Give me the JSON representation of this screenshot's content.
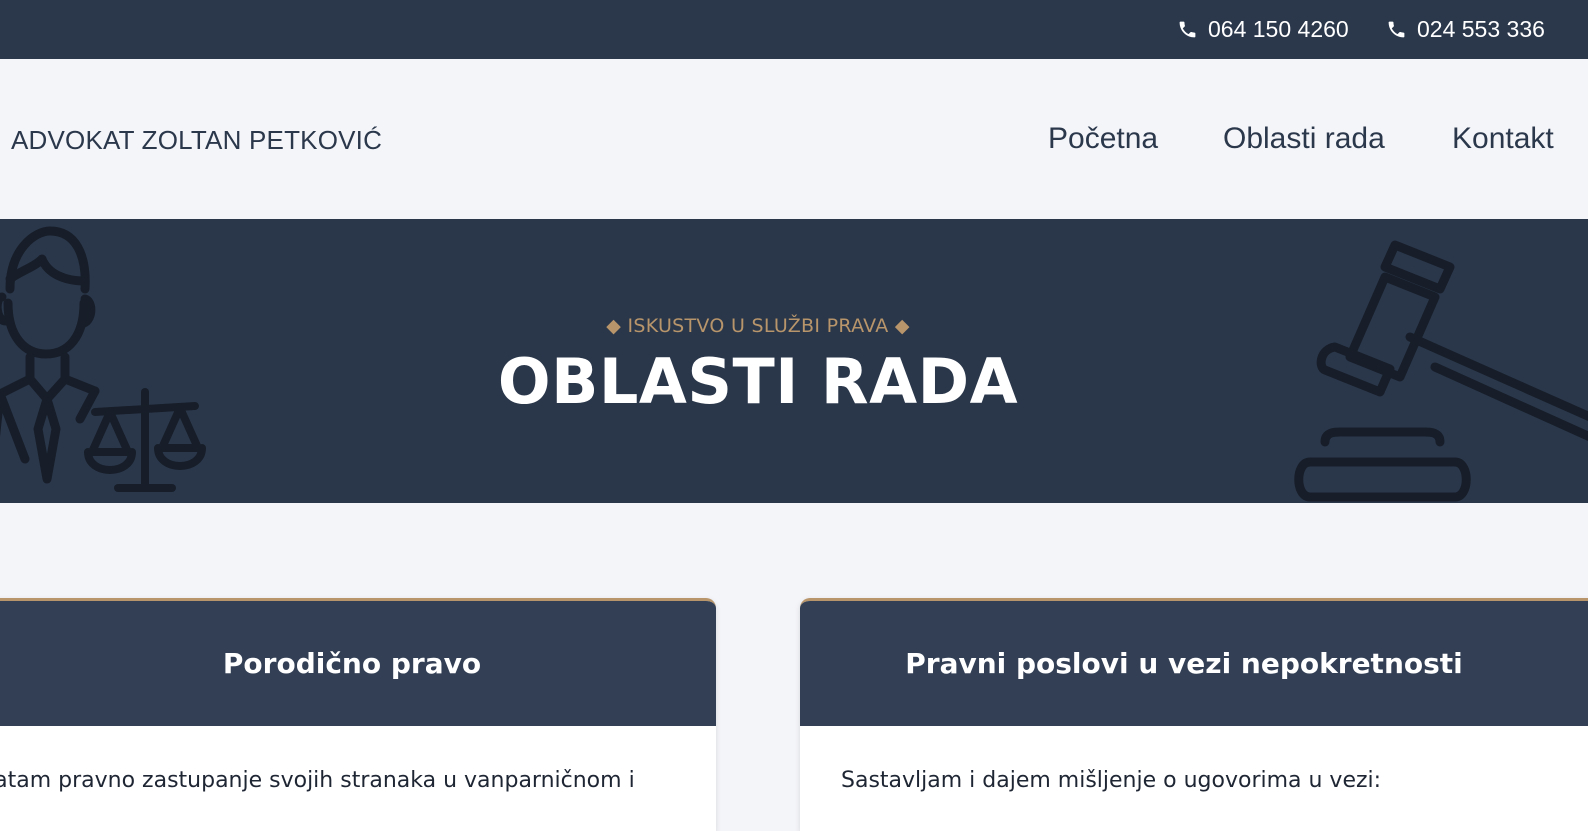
{
  "topbar": {
    "phones": [
      {
        "icon": "phone-icon",
        "number": "064 150 4260"
      },
      {
        "icon": "phone-icon",
        "number": "024 553 336"
      }
    ]
  },
  "navbar": {
    "brand": "ADVOKAT ZOLTAN PETKOVIĆ",
    "items": [
      {
        "label": "Početna"
      },
      {
        "label": "Oblasti rada"
      },
      {
        "label": "Kontakt"
      }
    ]
  },
  "hero": {
    "kicker": "◆ ISKUSTVO U SLUŽBI PRAVA ◆",
    "title": "OBLASTI RADA",
    "icons": [
      "lawyer-icon",
      "scales-icon",
      "gavel-icon"
    ]
  },
  "cards": [
    {
      "title": "Porodično pravo",
      "text": "rihvatam pravno zastupanje svojih stranaka u vanparničnom i"
    },
    {
      "title": "Pravni poslovi u vezi nepokretnosti",
      "text": "Sastavljam i dajem mišljenje o ugovorima u vezi:"
    }
  ],
  "colors": {
    "dark": "#2b384c",
    "card_header": "#323f55",
    "accent": "#b8956a",
    "background": "#f4f5f9"
  }
}
